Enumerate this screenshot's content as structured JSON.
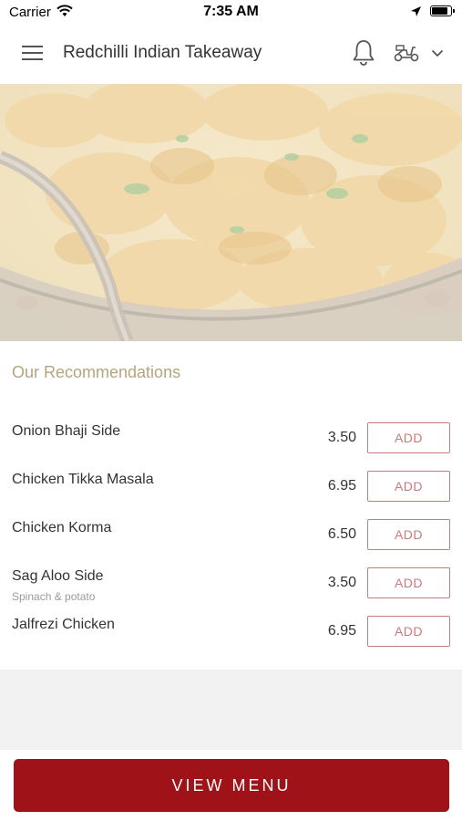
{
  "status_bar": {
    "carrier": "Carrier",
    "time": "7:35 AM",
    "battery_level": 0.85
  },
  "header": {
    "title": "Redchilli Indian Takeaway",
    "icons": [
      "menu-icon",
      "bell-icon",
      "scooter-icon",
      "chevron-down-icon"
    ]
  },
  "hero": {
    "image": "curry-dish-photo"
  },
  "recommendations": {
    "title": "Our Recommendations",
    "items": [
      {
        "name": "Onion Bhaji Side",
        "description": "",
        "price": "3.50",
        "button": "ADD"
      },
      {
        "name": "Chicken Tikka Masala",
        "description": "",
        "price": "6.95",
        "button": "ADD"
      },
      {
        "name": "Chicken Korma",
        "description": "",
        "price": "6.50",
        "button": "ADD"
      },
      {
        "name": "Sag Aloo Side",
        "description": "Spinach & potato",
        "price": "3.50",
        "button": "ADD"
      },
      {
        "name": "Jalfrezi Chicken",
        "description": "",
        "price": "6.95",
        "button": "ADD"
      }
    ]
  },
  "footer": {
    "view_menu_label": "VIEW MENU"
  },
  "colors": {
    "brand": "#9f1217",
    "add_button": "#c97b7b",
    "section_title": "#b3a57e"
  }
}
